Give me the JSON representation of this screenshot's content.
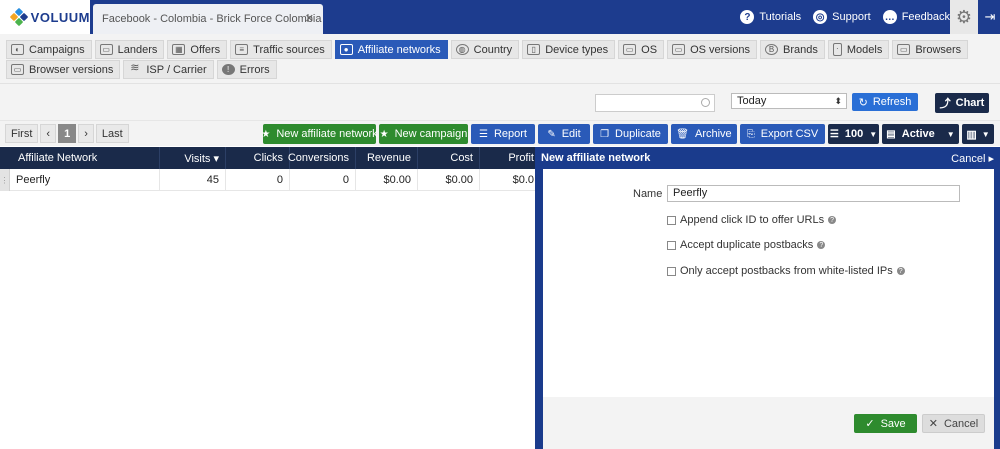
{
  "app": {
    "logo": "VOLUUM",
    "doc_tab": "Facebook - Colombia - Brick Force Colombia",
    "top_links": [
      {
        "label": "Tutorials",
        "icon": "question-icon"
      },
      {
        "label": "Support",
        "icon": "lifebuoy-icon"
      },
      {
        "label": "Feedback",
        "icon": "chat-bubble-icon"
      }
    ]
  },
  "nav": {
    "row1": [
      {
        "label": "Campaigns",
        "icon": "campaigns-icon",
        "active": false
      },
      {
        "label": "Landers",
        "icon": "landers-icon",
        "active": false
      },
      {
        "label": "Offers",
        "icon": "offers-icon",
        "active": false
      },
      {
        "label": "Traffic sources",
        "icon": "traffic-icon",
        "active": false
      },
      {
        "label": "Affiliate networks",
        "icon": "affiliate-icon",
        "active": true
      },
      {
        "label": "Country",
        "icon": "globe-icon",
        "active": false
      },
      {
        "label": "Device types",
        "icon": "device-icon",
        "active": false
      },
      {
        "label": "OS",
        "icon": "laptop-icon",
        "active": false
      },
      {
        "label": "OS versions",
        "icon": "laptop-icon",
        "active": false
      },
      {
        "label": "Brands",
        "icon": "brand-icon",
        "active": false
      },
      {
        "label": "Models",
        "icon": "phone-icon",
        "active": false
      },
      {
        "label": "Browsers",
        "icon": "browser-icon",
        "active": false
      }
    ],
    "row2": [
      {
        "label": "Browser versions",
        "icon": "browser-icon",
        "active": false
      },
      {
        "label": "ISP / Carrier",
        "icon": "wifi-icon",
        "active": false
      },
      {
        "label": "Errors",
        "icon": "error-icon",
        "active": false
      }
    ]
  },
  "filters": {
    "search_placeholder": "",
    "date_range": "Today",
    "refresh_label": "Refresh",
    "chart_label": "Chart"
  },
  "toolbar": {
    "first": "First",
    "prev": "‹",
    "page": "1",
    "next": "›",
    "last": "Last",
    "new_network": "New affiliate network",
    "new_campaign": "New campaign",
    "report": "Report",
    "edit": "Edit",
    "duplicate": "Duplicate",
    "archive": "Archive",
    "export": "Export CSV",
    "per_page": "100",
    "status": "Active"
  },
  "table": {
    "columns": [
      "Affiliate Network",
      "Visits ▾",
      "Clicks",
      "Conversions",
      "Revenue",
      "Cost",
      "Profit"
    ],
    "rows": [
      [
        "Peerfly",
        "45",
        "0",
        "0",
        "$0.00",
        "$0.00",
        "$0.0"
      ]
    ]
  },
  "panel": {
    "title": "New affiliate network",
    "cancel_link": "Cancel ▸",
    "name_label": "Name",
    "name_value": "Peerfly",
    "checkboxes": [
      "Append click ID to offer URLs",
      "Accept duplicate postbacks",
      "Only accept postbacks from white-listed IPs"
    ],
    "save_label": "Save",
    "cancel_label": "Cancel"
  },
  "colors": {
    "topbar": "#1d3c8e",
    "active_tab": "#2a5ab8",
    "green": "#2e8b2e",
    "dark_header": "#1a2a4a"
  }
}
